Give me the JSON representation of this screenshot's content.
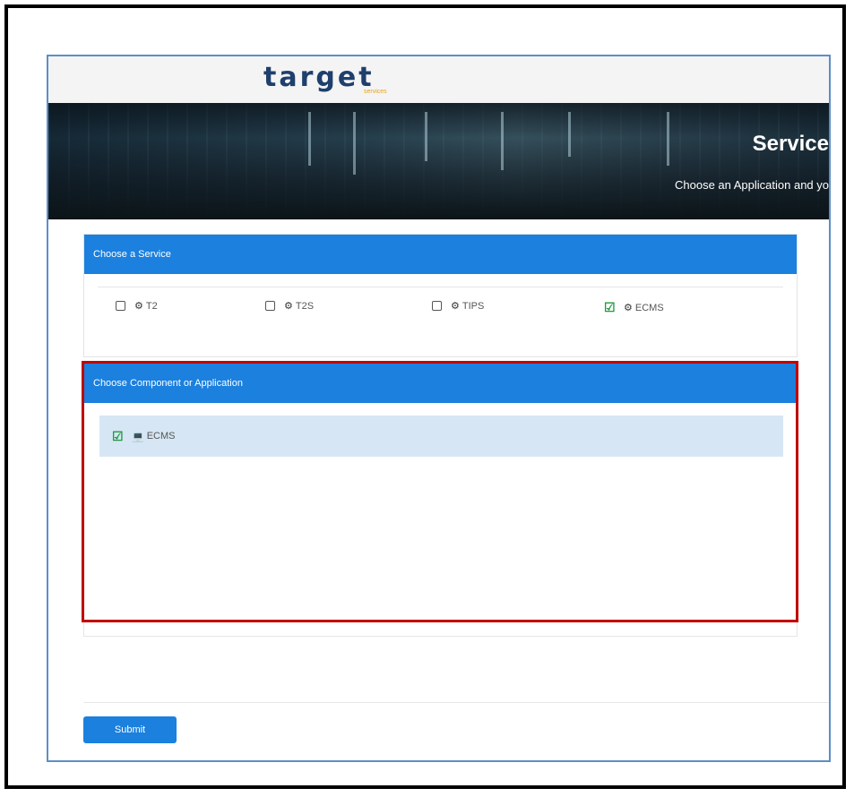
{
  "header": {
    "logo_text": "target",
    "logo_subtext": "services"
  },
  "banner": {
    "title": "Service",
    "subtitle": "Choose an Application and yo"
  },
  "services": {
    "title": "Choose a Service",
    "items": [
      {
        "label": "T2",
        "checked": false
      },
      {
        "label": "T2S",
        "checked": false
      },
      {
        "label": "TIPS",
        "checked": false
      },
      {
        "label": "ECMS",
        "checked": true
      }
    ]
  },
  "components": {
    "title": "Choose Component or Application",
    "items": [
      {
        "label": "ECMS",
        "checked": true
      }
    ]
  },
  "actions": {
    "submit_label": "Submit"
  },
  "colors": {
    "panel_header": "#1b80de",
    "highlight_border": "#c00000",
    "check": "#1f9b3d",
    "selected_row": "#d6e6f4"
  }
}
